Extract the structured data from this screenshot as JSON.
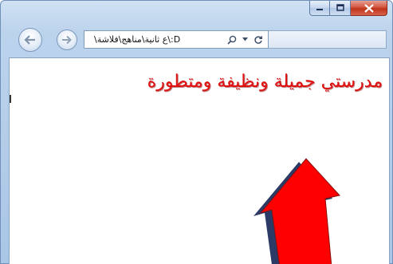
{
  "browser": {
    "address_text": "D:\\ع ثانية\\مناهج\\فلاشة\\",
    "window_buttons": [
      "minimize",
      "maximize",
      "close"
    ],
    "nav_icons": [
      "back-icon",
      "forward-icon",
      "search-icon",
      "dropdown-icon",
      "refresh-icon"
    ]
  },
  "page": {
    "heading": "مدرستي جميلة ونظيفة ومتطورة",
    "heading_color": "#e01010",
    "arrow_color": "#ff0000"
  }
}
